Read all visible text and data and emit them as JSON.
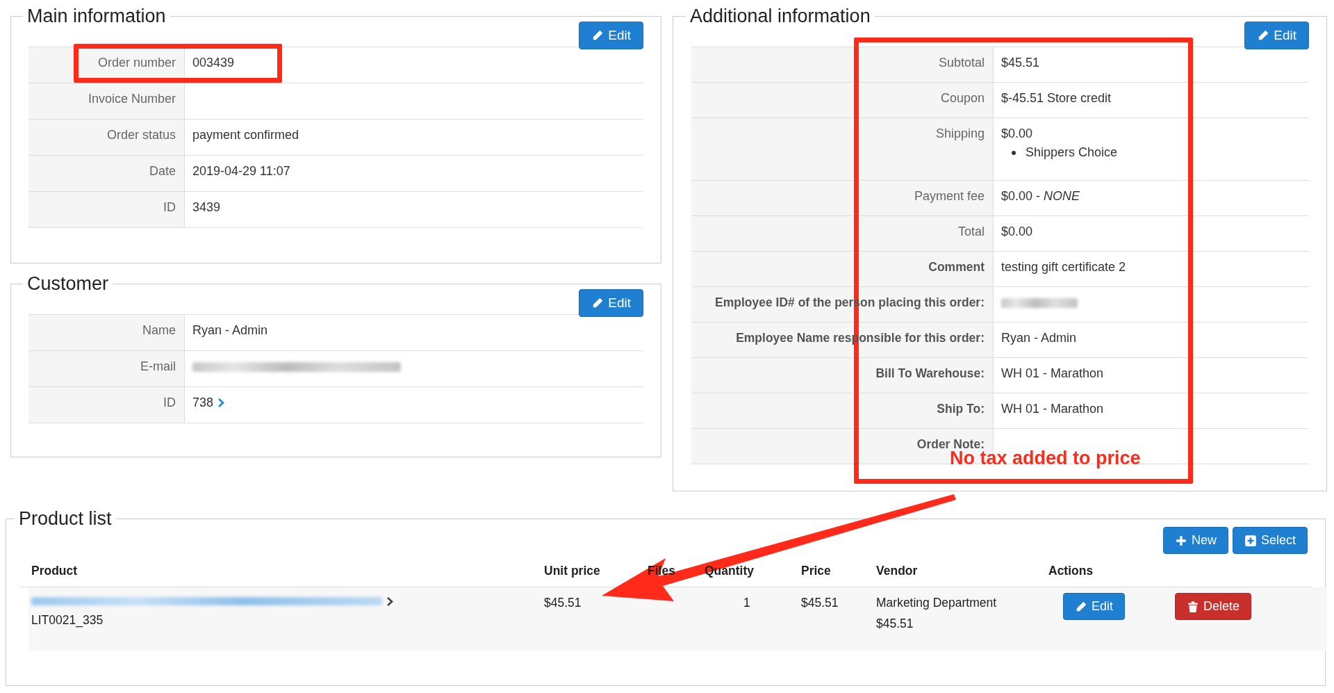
{
  "main_information": {
    "title": "Main information",
    "edit_button": "Edit",
    "rows": [
      {
        "label": "Order number",
        "value": "003439"
      },
      {
        "label": "Invoice Number"
      },
      {
        "label": "Order status",
        "value": "payment confirmed"
      },
      {
        "label": "Date",
        "value": "2019-04-29 11:07"
      },
      {
        "label": "ID",
        "value": "3439"
      }
    ]
  },
  "customer": {
    "title": "Customer",
    "edit_button": "Edit",
    "rows": [
      {
        "label": "Name",
        "kind": "text",
        "value": "Ryan - Admin"
      },
      {
        "label": "E-mail",
        "kind": "blurred"
      },
      {
        "label": "ID",
        "kind": "link",
        "value": "738"
      }
    ]
  },
  "additional_information": {
    "title": "Additional information",
    "edit_button": "Edit",
    "rows": [
      {
        "label": "Subtotal",
        "label_bold": false,
        "value": "$45.51"
      },
      {
        "label": "Coupon",
        "label_bold": false,
        "value": "$-45.51 Store credit"
      },
      {
        "label": "Shipping",
        "label_bold": false,
        "value": "$0.00",
        "bullets": [
          "Shippers Choice"
        ]
      },
      {
        "label": "Payment fee",
        "label_bold": false,
        "value": "$0.00 - *NONE*"
      },
      {
        "label": "Total",
        "label_bold": false,
        "value": "$0.00"
      },
      {
        "label": "Comment",
        "label_bold": true,
        "value": "testing gift certificate 2"
      },
      {
        "label": "Employee ID# of the person placing this order:",
        "label_bold": true,
        "blurred": true
      },
      {
        "label": "Employee Name responsible for this order:",
        "label_bold": true,
        "value": "Ryan - Admin"
      },
      {
        "label": "Bill To Warehouse:",
        "label_bold": true,
        "value": "WH 01 - Marathon"
      },
      {
        "label": "Ship To:",
        "label_bold": true,
        "value": "WH 01 - Marathon"
      },
      {
        "label": "Order Note:",
        "label_bold": true
      }
    ]
  },
  "product_list": {
    "title": "Product list",
    "buttons": [
      {
        "label": "New"
      },
      {
        "label": "Select"
      }
    ],
    "columns": [
      "Product",
      "Unit price",
      "Files",
      "Quantity",
      "Price",
      "Vendor",
      "Actions"
    ],
    "rows": [
      {
        "sku": "LIT0021_335",
        "unit_price": "$45.51",
        "quantity": "1",
        "price": "$45.51",
        "vendor": "Marketing Department",
        "vendor_price": "$45.51",
        "edit_button": "Edit",
        "delete_button": "Delete"
      }
    ]
  },
  "annotation": {
    "note": "No tax added to price"
  }
}
